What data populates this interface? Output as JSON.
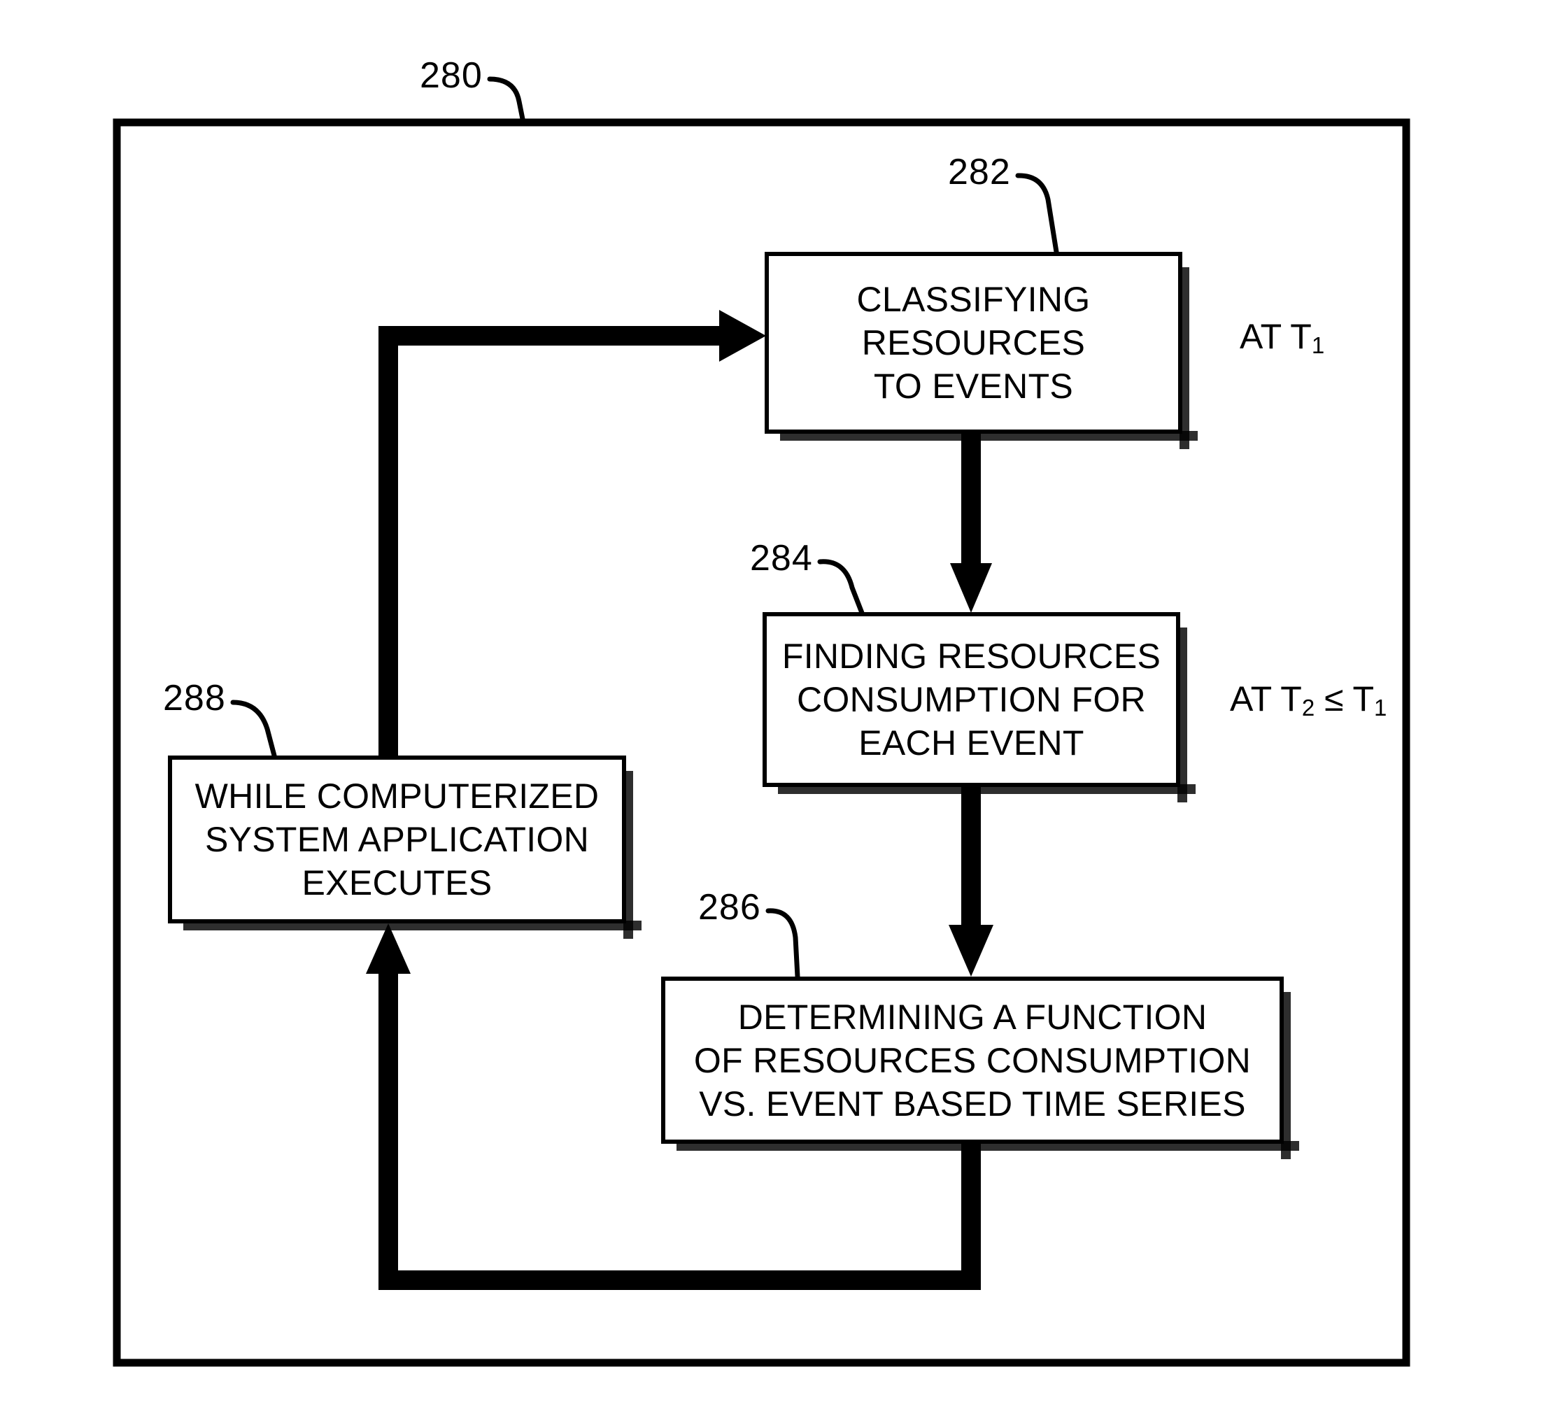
{
  "figure": {
    "outer_label": "280",
    "boxes": [
      {
        "ref": "282",
        "text": "CLASSIFYING\nRESOURCES\nTO EVENTS",
        "note": "AT T",
        "note_sub": "1"
      },
      {
        "ref": "284",
        "text": "FINDING RESOURCES\nCONSUMPTION FOR\nEACH EVENT",
        "note": "AT T",
        "note_sub": "2",
        "note_tail": " ≤ T",
        "note_tail_sub": "1"
      },
      {
        "ref": "286",
        "text": "DETERMINING A FUNCTION\nOF RESOURCES CONSUMPTION\nVS. EVENT BASED TIME SERIES"
      },
      {
        "ref": "288",
        "text": "WHILE COMPUTERIZED\nSYSTEM APPLICATION\nEXECUTES"
      }
    ],
    "colors": {
      "ink": "#000000",
      "paper": "#ffffff"
    }
  }
}
